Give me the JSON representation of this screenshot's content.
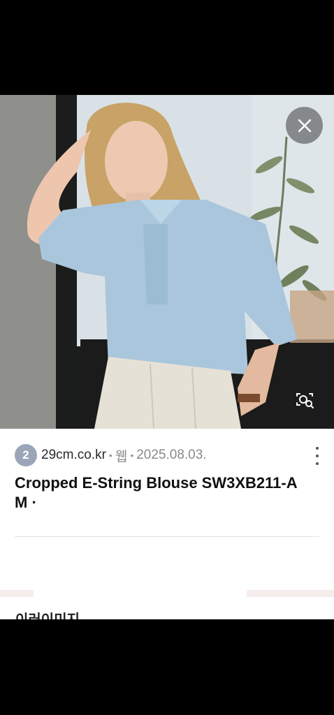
{
  "result": {
    "favicon_number": "2",
    "site": "29cm.co.kr",
    "source_type": "웹",
    "date": "2025.08.03.",
    "title": "Cropped E-String Blouse SW3XB211-A",
    "title_line2": "M · ",
    "next_section_peek": "이러이미지"
  },
  "controls": {
    "close_icon": "close-icon",
    "lens_icon": "image-search-icon",
    "more_icon": "more-vertical-icon"
  },
  "colors": {
    "shirt": "#a9c6dc",
    "card_background": "#ffffff",
    "favicon": "#9aa6b8"
  }
}
